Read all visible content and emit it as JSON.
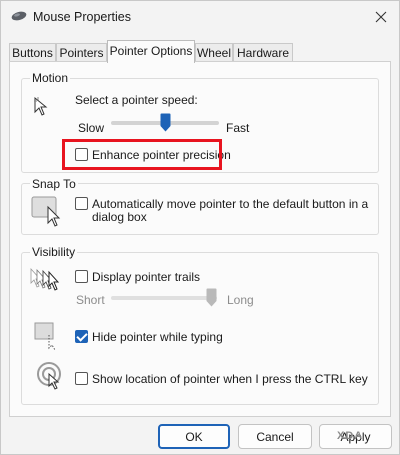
{
  "window": {
    "title": "Mouse Properties"
  },
  "tabs": [
    {
      "label": "Buttons"
    },
    {
      "label": "Pointers"
    },
    {
      "label": "Pointer Options"
    },
    {
      "label": "Wheel"
    },
    {
      "label": "Hardware"
    }
  ],
  "active_tab": "Pointer Options",
  "motion": {
    "group_label": "Motion",
    "speed_label": "Select a pointer speed:",
    "slow_label": "Slow",
    "fast_label": "Fast",
    "speed_value_fraction": 0.5,
    "enhance_precision_label": "Enhance pointer precision",
    "enhance_precision_checked": false
  },
  "snap_to": {
    "group_label": "Snap To",
    "auto_move_label_line1": "Automatically move pointer to the default button in a",
    "auto_move_label_line2": "dialog box",
    "auto_move_checked": false
  },
  "visibility": {
    "group_label": "Visibility",
    "trails_label": "Display pointer trails",
    "trails_checked": false,
    "short_label": "Short",
    "long_label": "Long",
    "trail_length_fraction": 1.0,
    "hide_typing_label": "Hide pointer while typing",
    "hide_typing_checked": true,
    "show_location_label": "Show location of pointer when I press the CTRL key",
    "show_location_checked": false
  },
  "footer": {
    "ok_label": "OK",
    "cancel_label": "Cancel",
    "apply_label": "Apply",
    "watermark": "XDA"
  },
  "colors": {
    "accent": "#1e63b7",
    "highlight_box": "#e8141f"
  }
}
